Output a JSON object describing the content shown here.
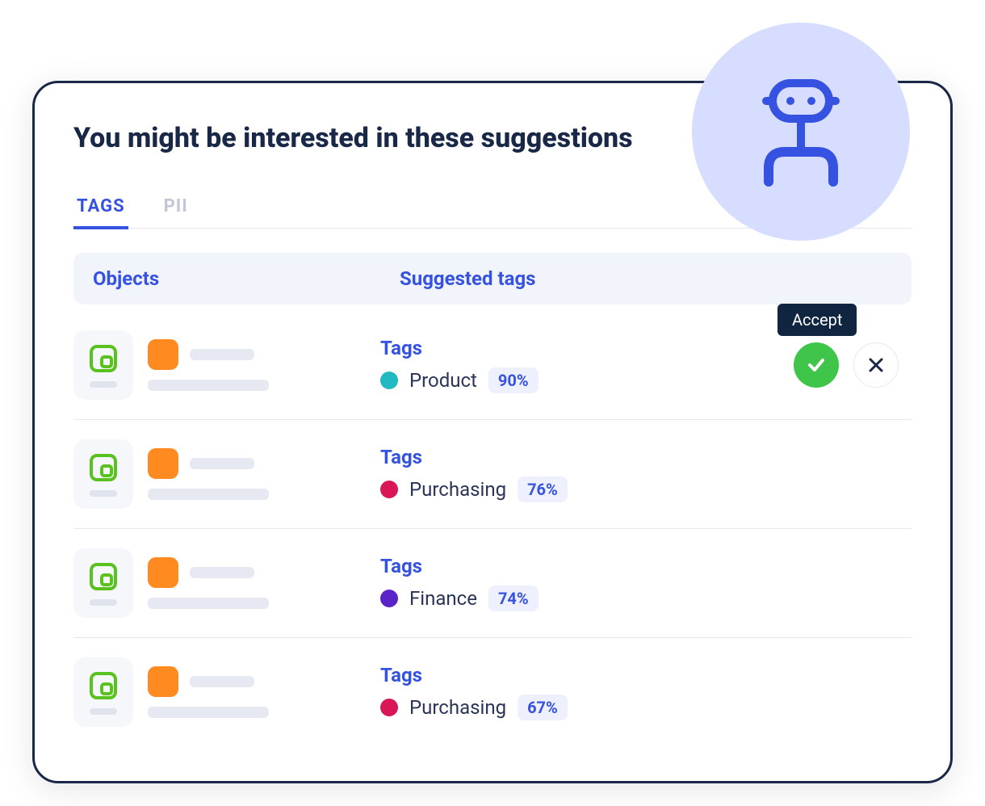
{
  "title": "You might be interested in these suggestions",
  "tabs": [
    {
      "label": "TAGS",
      "active": true
    },
    {
      "label": "PII",
      "active": false
    }
  ],
  "headers": {
    "objects": "Objects",
    "suggested": "Suggested tags"
  },
  "tags_label": "Tags",
  "tooltip_accept": "Accept",
  "rows": [
    {
      "tag_name": "Product",
      "percent": "90%",
      "dot_color": "#22b9c2",
      "show_actions": true
    },
    {
      "tag_name": "Purchasing",
      "percent": "76%",
      "dot_color": "#d91756",
      "show_actions": false
    },
    {
      "tag_name": "Finance",
      "percent": "74%",
      "dot_color": "#5a24c9",
      "show_actions": false
    },
    {
      "tag_name": "Purchasing",
      "percent": "67%",
      "dot_color": "#d91756",
      "show_actions": false
    }
  ]
}
